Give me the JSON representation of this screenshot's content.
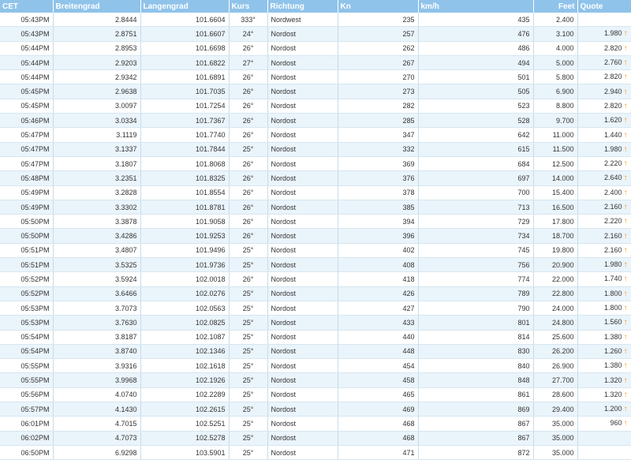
{
  "columns": [
    "CET",
    "Breitengrad",
    "Langengrad",
    "Kurs",
    "Richtung",
    "Kn",
    "km/h",
    "Feet",
    "Quote"
  ],
  "rows": [
    {
      "time": "05:43PM",
      "lat": "2.8444",
      "lon": "101.6604",
      "course": "333°",
      "dir": "Nordwest",
      "kn": "235",
      "kmh": "435",
      "feet": "2.400",
      "quote": "",
      "arrow": ""
    },
    {
      "time": "05:43PM",
      "lat": "2.8751",
      "lon": "101.6607",
      "course": "24°",
      "dir": "Nordost",
      "kn": "257",
      "kmh": "476",
      "feet": "3.100",
      "quote": "1.980",
      "arrow": "up-arrow"
    },
    {
      "time": "05:44PM",
      "lat": "2.8953",
      "lon": "101.6698",
      "course": "26°",
      "dir": "Nordost",
      "kn": "262",
      "kmh": "486",
      "feet": "4.000",
      "quote": "2.820",
      "arrow": "up-arrow"
    },
    {
      "time": "05:44PM",
      "lat": "2.9203",
      "lon": "101.6822",
      "course": "27°",
      "dir": "Nordost",
      "kn": "267",
      "kmh": "494",
      "feet": "5.000",
      "quote": "2.760",
      "arrow": "up-arrow"
    },
    {
      "time": "05:44PM",
      "lat": "2.9342",
      "lon": "101.6891",
      "course": "26°",
      "dir": "Nordost",
      "kn": "270",
      "kmh": "501",
      "feet": "5.800",
      "quote": "2.820",
      "arrow": "up-arrow"
    },
    {
      "time": "05:45PM",
      "lat": "2.9638",
      "lon": "101.7035",
      "course": "26°",
      "dir": "Nordost",
      "kn": "273",
      "kmh": "505",
      "feet": "6.900",
      "quote": "2.940",
      "arrow": "up-arrow"
    },
    {
      "time": "05:45PM",
      "lat": "3.0097",
      "lon": "101.7254",
      "course": "26°",
      "dir": "Nordost",
      "kn": "282",
      "kmh": "523",
      "feet": "8.800",
      "quote": "2.820",
      "arrow": "up-arrow"
    },
    {
      "time": "05:46PM",
      "lat": "3.0334",
      "lon": "101.7367",
      "course": "26°",
      "dir": "Nordost",
      "kn": "285",
      "kmh": "528",
      "feet": "9.700",
      "quote": "1.620",
      "arrow": "up-arrow"
    },
    {
      "time": "05:47PM",
      "lat": "3.1119",
      "lon": "101.7740",
      "course": "26°",
      "dir": "Nordost",
      "kn": "347",
      "kmh": "642",
      "feet": "11.000",
      "quote": "1.440",
      "arrow": "up-arrow"
    },
    {
      "time": "05:47PM",
      "lat": "3.1337",
      "lon": "101.7844",
      "course": "25°",
      "dir": "Nordost",
      "kn": "332",
      "kmh": "615",
      "feet": "11.500",
      "quote": "1.980",
      "arrow": "up-arrow"
    },
    {
      "time": "05:47PM",
      "lat": "3.1807",
      "lon": "101.8068",
      "course": "26°",
      "dir": "Nordost",
      "kn": "369",
      "kmh": "684",
      "feet": "12.500",
      "quote": "2.220",
      "arrow": "up-arrow"
    },
    {
      "time": "05:48PM",
      "lat": "3.2351",
      "lon": "101.8325",
      "course": "26°",
      "dir": "Nordost",
      "kn": "376",
      "kmh": "697",
      "feet": "14.000",
      "quote": "2.640",
      "arrow": "up-arrow"
    },
    {
      "time": "05:49PM",
      "lat": "3.2828",
      "lon": "101.8554",
      "course": "26°",
      "dir": "Nordost",
      "kn": "378",
      "kmh": "700",
      "feet": "15.400",
      "quote": "2.400",
      "arrow": "up-arrow"
    },
    {
      "time": "05:49PM",
      "lat": "3.3302",
      "lon": "101.8781",
      "course": "26°",
      "dir": "Nordost",
      "kn": "385",
      "kmh": "713",
      "feet": "16.500",
      "quote": "2.160",
      "arrow": "up-arrow"
    },
    {
      "time": "05:50PM",
      "lat": "3.3878",
      "lon": "101.9058",
      "course": "26°",
      "dir": "Nordost",
      "kn": "394",
      "kmh": "729",
      "feet": "17.800",
      "quote": "2.220",
      "arrow": "up-arrow"
    },
    {
      "time": "05:50PM",
      "lat": "3.4286",
      "lon": "101.9253",
      "course": "26°",
      "dir": "Nordost",
      "kn": "396",
      "kmh": "734",
      "feet": "18.700",
      "quote": "2.160",
      "arrow": "up-arrow"
    },
    {
      "time": "05:51PM",
      "lat": "3.4807",
      "lon": "101.9496",
      "course": "25°",
      "dir": "Nordost",
      "kn": "402",
      "kmh": "745",
      "feet": "19.800",
      "quote": "2.160",
      "arrow": "up-arrow"
    },
    {
      "time": "05:51PM",
      "lat": "3.5325",
      "lon": "101.9736",
      "course": "25°",
      "dir": "Nordost",
      "kn": "408",
      "kmh": "756",
      "feet": "20.900",
      "quote": "1.980",
      "arrow": "up-arrow"
    },
    {
      "time": "05:52PM",
      "lat": "3.5924",
      "lon": "102.0018",
      "course": "26°",
      "dir": "Nordost",
      "kn": "418",
      "kmh": "774",
      "feet": "22.000",
      "quote": "1.740",
      "arrow": "up-arrow"
    },
    {
      "time": "05:52PM",
      "lat": "3.6466",
      "lon": "102.0276",
      "course": "25°",
      "dir": "Nordost",
      "kn": "426",
      "kmh": "789",
      "feet": "22.800",
      "quote": "1.800",
      "arrow": "up-arrow"
    },
    {
      "time": "05:53PM",
      "lat": "3.7073",
      "lon": "102.0563",
      "course": "25°",
      "dir": "Nordost",
      "kn": "427",
      "kmh": "790",
      "feet": "24.000",
      "quote": "1.800",
      "arrow": "up-arrow"
    },
    {
      "time": "05:53PM",
      "lat": "3.7630",
      "lon": "102.0825",
      "course": "25°",
      "dir": "Nordost",
      "kn": "433",
      "kmh": "801",
      "feet": "24.800",
      "quote": "1.560",
      "arrow": "up-arrow"
    },
    {
      "time": "05:54PM",
      "lat": "3.8187",
      "lon": "102.1087",
      "course": "25°",
      "dir": "Nordost",
      "kn": "440",
      "kmh": "814",
      "feet": "25.600",
      "quote": "1.380",
      "arrow": "up-arrow"
    },
    {
      "time": "05:54PM",
      "lat": "3.8740",
      "lon": "102.1346",
      "course": "25°",
      "dir": "Nordost",
      "kn": "448",
      "kmh": "830",
      "feet": "26.200",
      "quote": "1.260",
      "arrow": "up-arrow"
    },
    {
      "time": "05:55PM",
      "lat": "3.9316",
      "lon": "102.1618",
      "course": "25°",
      "dir": "Nordost",
      "kn": "454",
      "kmh": "840",
      "feet": "26.900",
      "quote": "1.380",
      "arrow": "up-arrow"
    },
    {
      "time": "05:55PM",
      "lat": "3.9968",
      "lon": "102.1926",
      "course": "25°",
      "dir": "Nordost",
      "kn": "458",
      "kmh": "848",
      "feet": "27.700",
      "quote": "1.320",
      "arrow": "up-arrow"
    },
    {
      "time": "05:56PM",
      "lat": "4.0740",
      "lon": "102.2289",
      "course": "25°",
      "dir": "Nordost",
      "kn": "465",
      "kmh": "861",
      "feet": "28.600",
      "quote": "1.320",
      "arrow": "up-arrow"
    },
    {
      "time": "05:57PM",
      "lat": "4.1430",
      "lon": "102.2615",
      "course": "25°",
      "dir": "Nordost",
      "kn": "469",
      "kmh": "869",
      "feet": "29.400",
      "quote": "1.200",
      "arrow": "up-arrow"
    },
    {
      "time": "06:01PM",
      "lat": "4.7015",
      "lon": "102.5251",
      "course": "25°",
      "dir": "Nordost",
      "kn": "468",
      "kmh": "867",
      "feet": "35.000",
      "quote": "960",
      "arrow": "up-arrow"
    },
    {
      "time": "06:02PM",
      "lat": "4.7073",
      "lon": "102.5278",
      "course": "25°",
      "dir": "Nordost",
      "kn": "468",
      "kmh": "867",
      "feet": "35.000",
      "quote": "",
      "arrow": ""
    },
    {
      "time": "06:50PM",
      "lat": "6.9298",
      "lon": "103.5901",
      "course": "25°",
      "dir": "Nordost",
      "kn": "471",
      "kmh": "872",
      "feet": "35.000",
      "quote": "",
      "arrow": ""
    }
  ],
  "colors": {
    "header_bg": "#8fc3ea",
    "row_alt_bg": "#eaf4fb",
    "arrow": "#f29a1c"
  }
}
